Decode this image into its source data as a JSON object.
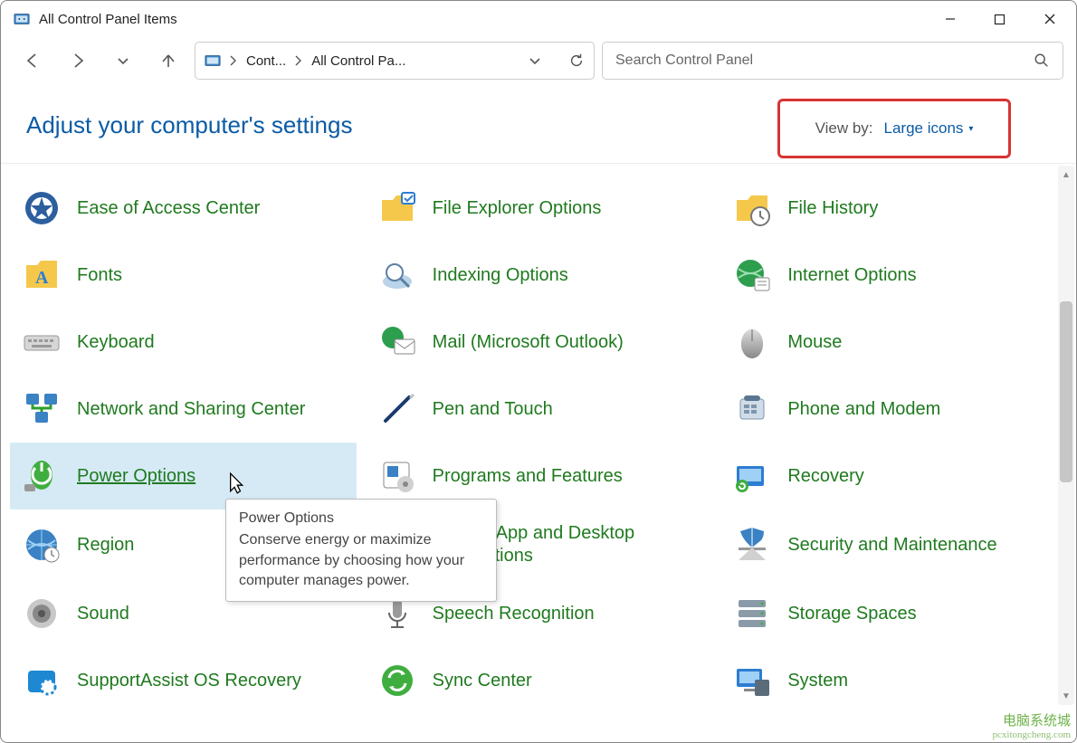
{
  "window": {
    "title": "All Control Panel Items"
  },
  "breadcrumb": {
    "part1": "Cont...",
    "part2": "All Control Pa..."
  },
  "search": {
    "placeholder": "Search Control Panel"
  },
  "heading": "Adjust your computer's settings",
  "viewby": {
    "label": "View by:",
    "value": "Large icons"
  },
  "tooltip": {
    "title": "Power Options",
    "body": "Conserve energy or maximize performance by choosing how your computer manages power."
  },
  "items": [
    {
      "label": "Ease of Access Center",
      "icon": "ease-access-icon"
    },
    {
      "label": "File Explorer Options",
      "icon": "folder-options-icon"
    },
    {
      "label": "File History",
      "icon": "file-history-icon"
    },
    {
      "label": "Fonts",
      "icon": "fonts-icon"
    },
    {
      "label": "Indexing Options",
      "icon": "indexing-icon"
    },
    {
      "label": "Internet Options",
      "icon": "internet-options-icon"
    },
    {
      "label": "Keyboard",
      "icon": "keyboard-icon"
    },
    {
      "label": "Mail (Microsoft Outlook)",
      "icon": "mail-icon"
    },
    {
      "label": "Mouse",
      "icon": "mouse-icon"
    },
    {
      "label": "Network and Sharing Center",
      "icon": "network-icon"
    },
    {
      "label": "Pen and Touch",
      "icon": "pen-icon"
    },
    {
      "label": "Phone and Modem",
      "icon": "phone-icon"
    },
    {
      "label": "Power Options",
      "icon": "power-icon",
      "hover": true
    },
    {
      "label": "Programs and Features",
      "icon": "programs-icon"
    },
    {
      "label": "Recovery",
      "icon": "recovery-icon"
    },
    {
      "label": "Region",
      "icon": "region-icon"
    },
    {
      "label": "RemoteApp and Desktop Connections",
      "icon": "remoteapp-icon",
      "wrap": "App and Desktop\ntions"
    },
    {
      "label": "Security and Maintenance",
      "icon": "security-icon"
    },
    {
      "label": "Sound",
      "icon": "sound-icon"
    },
    {
      "label": "Speech Recognition",
      "icon": "speech-icon"
    },
    {
      "label": "Storage Spaces",
      "icon": "storage-icon"
    },
    {
      "label": "SupportAssist OS Recovery",
      "icon": "supportassist-icon"
    },
    {
      "label": "Sync Center",
      "icon": "sync-icon"
    },
    {
      "label": "System",
      "icon": "system-icon"
    }
  ],
  "watermark": {
    "cn": "电脑系统城",
    "url": "pcxitongcheng.com"
  }
}
